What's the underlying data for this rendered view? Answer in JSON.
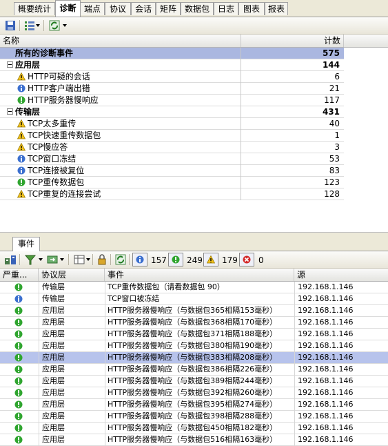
{
  "tabs": [
    "概要统计",
    "诊断",
    "端点",
    "协议",
    "会话",
    "矩阵",
    "数据包",
    "日志",
    "图表",
    "报表"
  ],
  "active_tab": 1,
  "diag_table": {
    "headers": {
      "name": "名称",
      "count": "计数"
    },
    "rows": [
      {
        "kind": "total",
        "label": "所有的诊断事件",
        "count": "575",
        "icon": ""
      },
      {
        "kind": "group",
        "label": "应用层",
        "count": "144",
        "icon": "collapse-icon"
      },
      {
        "kind": "item",
        "label": "HTTP可疑的会话",
        "count": "6",
        "icon": "warning-icon"
      },
      {
        "kind": "item",
        "label": "HTTP客户端出错",
        "count": "21",
        "icon": "info-icon"
      },
      {
        "kind": "item",
        "label": "HTTP服务器慢响应",
        "count": "117",
        "icon": "ok-icon"
      },
      {
        "kind": "group",
        "label": "传输层",
        "count": "431",
        "icon": "collapse-icon"
      },
      {
        "kind": "item",
        "label": "TCP太多重传",
        "count": "40",
        "icon": "warning-icon"
      },
      {
        "kind": "item",
        "label": "TCP快速重传数据包",
        "count": "1",
        "icon": "warning-icon"
      },
      {
        "kind": "item",
        "label": "TCP慢应答",
        "count": "3",
        "icon": "warning-icon"
      },
      {
        "kind": "item",
        "label": "TCP窗口冻结",
        "count": "53",
        "icon": "info-icon"
      },
      {
        "kind": "item",
        "label": "TCP连接被复位",
        "count": "83",
        "icon": "info-icon"
      },
      {
        "kind": "item",
        "label": "TCP重传数据包",
        "count": "123",
        "icon": "ok-icon"
      },
      {
        "kind": "item",
        "label": "TCP重复的连接尝试",
        "count": "128",
        "icon": "warning-icon"
      }
    ]
  },
  "events_tab": {
    "label": "事件"
  },
  "event_counters": {
    "info": "157",
    "ok": "249",
    "warning": "179",
    "error": "0"
  },
  "events_table": {
    "headers": {
      "severity": "严重...",
      "layer": "协议层",
      "event": "事件",
      "source": "源"
    },
    "rows": [
      {
        "severity": "ok-icon",
        "layer": "传输层",
        "event": "TCP重传数据包（请看数据包 90）",
        "source": "192.168.1.146"
      },
      {
        "severity": "info-icon",
        "layer": "传输层",
        "event": "TCP窗口被冻结",
        "source": "192.168.1.146"
      },
      {
        "severity": "ok-icon",
        "layer": "应用层",
        "event": "HTTP服务器慢响应（与数据包365相隔153毫秒）",
        "source": "192.168.1.146"
      },
      {
        "severity": "ok-icon",
        "layer": "应用层",
        "event": "HTTP服务器慢响应（与数据包368相隔170毫秒）",
        "source": "192.168.1.146"
      },
      {
        "severity": "ok-icon",
        "layer": "应用层",
        "event": "HTTP服务器慢响应（与数据包371相隔188毫秒）",
        "source": "192.168.1.146"
      },
      {
        "severity": "ok-icon",
        "layer": "应用层",
        "event": "HTTP服务器慢响应（与数据包380相隔190毫秒）",
        "source": "192.168.1.146"
      },
      {
        "severity": "ok-icon",
        "layer": "应用层",
        "event": "HTTP服务器慢响应（与数据包383相隔208毫秒）",
        "source": "192.168.1.146"
      },
      {
        "severity": "ok-icon",
        "layer": "应用层",
        "event": "HTTP服务器慢响应（与数据包386相隔226毫秒）",
        "source": "192.168.1.146"
      },
      {
        "severity": "ok-icon",
        "layer": "应用层",
        "event": "HTTP服务器慢响应（与数据包389相隔244毫秒）",
        "source": "192.168.1.146"
      },
      {
        "severity": "ok-icon",
        "layer": "应用层",
        "event": "HTTP服务器慢响应（与数据包392相隔260毫秒）",
        "source": "192.168.1.146"
      },
      {
        "severity": "ok-icon",
        "layer": "应用层",
        "event": "HTTP服务器慢响应（与数据包395相隔274毫秒）",
        "source": "192.168.1.146"
      },
      {
        "severity": "ok-icon",
        "layer": "应用层",
        "event": "HTTP服务器慢响应（与数据包398相隔288毫秒）",
        "source": "192.168.1.146"
      },
      {
        "severity": "ok-icon",
        "layer": "应用层",
        "event": "HTTP服务器慢响应（与数据包450相隔182毫秒）",
        "source": "192.168.1.146"
      },
      {
        "severity": "ok-icon",
        "layer": "应用层",
        "event": "HTTP服务器慢响应（与数据包516相隔163毫秒）",
        "source": "192.168.1.146"
      }
    ],
    "selected_row": 6
  }
}
